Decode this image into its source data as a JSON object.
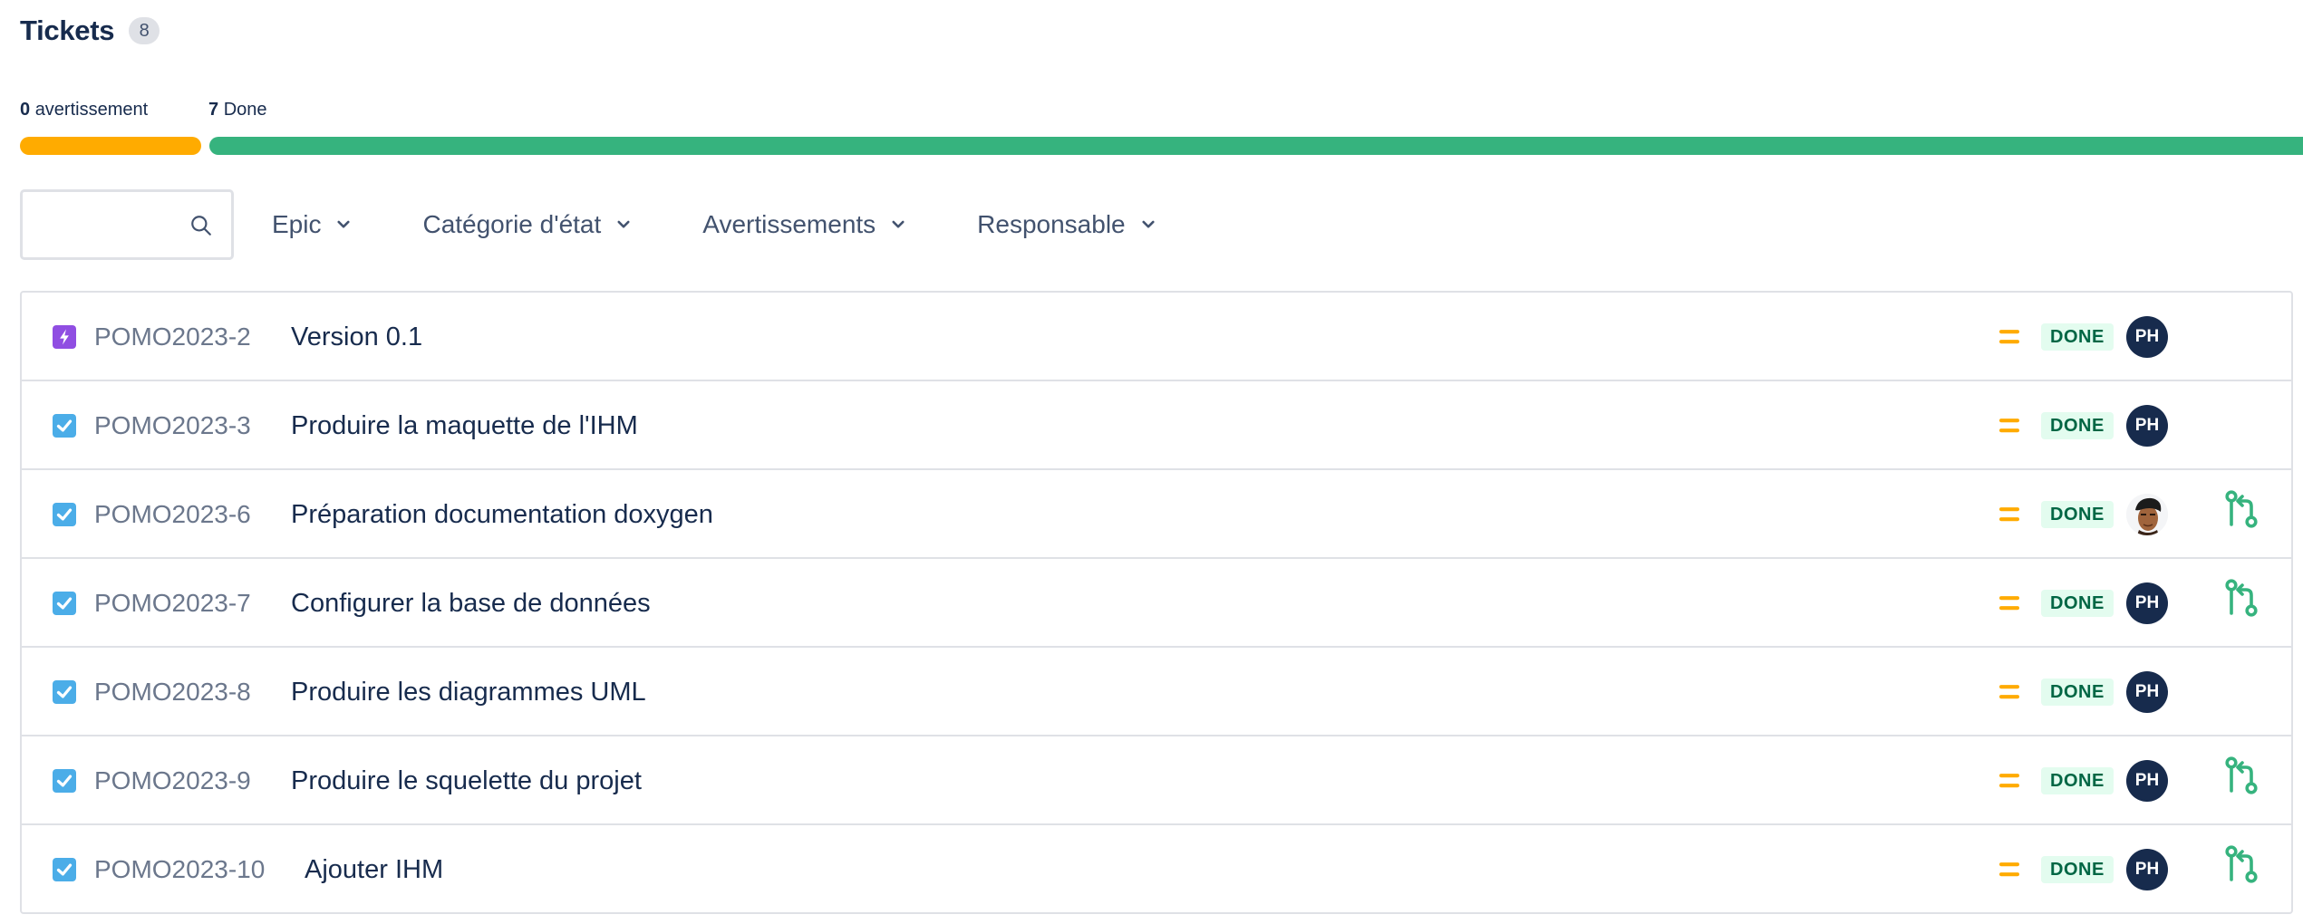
{
  "header": {
    "title": "Tickets",
    "count": "8"
  },
  "progress": {
    "warning_count": "0",
    "warning_label": "avertissement",
    "done_count": "7",
    "done_label": "Done",
    "warning_color": "#ffab00",
    "done_color": "#36b37e"
  },
  "filters": {
    "search_placeholder": "",
    "search_value": "",
    "epic": "Epic",
    "status_category": "Catégorie d'état",
    "warnings": "Avertissements",
    "assignee": "Responsable"
  },
  "tickets": [
    {
      "type": "epic",
      "type_icon": "lightning-icon",
      "key": "POMO2023-2",
      "summary": "Version 0.1",
      "priority": "medium",
      "status": "DONE",
      "assignee": "PH",
      "has_pr": false
    },
    {
      "type": "task",
      "type_icon": "checkbox-icon",
      "key": "POMO2023-3",
      "summary": "Produire la maquette de l'IHM",
      "priority": "medium",
      "status": "DONE",
      "assignee": "PH",
      "has_pr": false
    },
    {
      "type": "task",
      "type_icon": "checkbox-icon",
      "key": "POMO2023-6",
      "summary": "Préparation documentation doxygen",
      "priority": "medium",
      "status": "DONE",
      "assignee": "photo",
      "has_pr": true
    },
    {
      "type": "task",
      "type_icon": "checkbox-icon",
      "key": "POMO2023-7",
      "summary": "Configurer la base de données",
      "priority": "medium",
      "status": "DONE",
      "assignee": "PH",
      "has_pr": true
    },
    {
      "type": "task",
      "type_icon": "checkbox-icon",
      "key": "POMO2023-8",
      "summary": "Produire les diagrammes UML",
      "priority": "medium",
      "status": "DONE",
      "assignee": "PH",
      "has_pr": false
    },
    {
      "type": "task",
      "type_icon": "checkbox-icon",
      "key": "POMO2023-9",
      "summary": "Produire le squelette du projet",
      "priority": "medium",
      "status": "DONE",
      "assignee": "PH",
      "has_pr": true
    },
    {
      "type": "task",
      "type_icon": "checkbox-icon",
      "key": "POMO2023-10",
      "summary": "Ajouter IHM",
      "priority": "medium",
      "status": "DONE",
      "assignee": "PH",
      "has_pr": true
    }
  ],
  "colors": {
    "epic": "#904ee2",
    "task": "#4bade8",
    "priority_medium": "#ffab00",
    "status_done_bg": "#e3fcef",
    "status_done_text": "#006644",
    "avatar_bg": "#172b4d",
    "pr_icon": "#36b37e"
  }
}
